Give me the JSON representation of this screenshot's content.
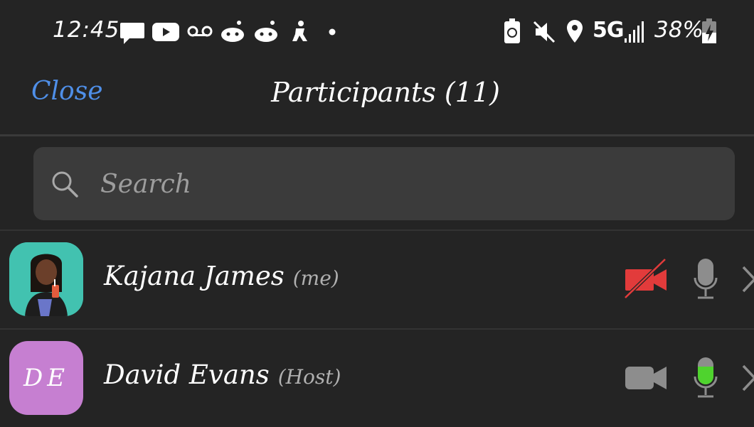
{
  "status_bar": {
    "time": "12:45",
    "network": "5G",
    "battery": "38%",
    "icons": [
      "message-icon",
      "youtube-icon",
      "voicemail-icon",
      "reddit-icon",
      "reddit-icon",
      "gym-icon",
      "dot-icon",
      "battery-saver-icon",
      "mute-icon",
      "location-icon",
      "signal-icon",
      "battery-charging-icon"
    ]
  },
  "header": {
    "close_label": "Close",
    "title": "Participants (11)"
  },
  "search": {
    "placeholder": "Search"
  },
  "participants": [
    {
      "name": "Kajana James",
      "tag": "(me)",
      "avatar_type": "photo",
      "video": "off",
      "mic": "muted"
    },
    {
      "name": "David Evans",
      "tag": "(Host)",
      "avatar_initials": "DE",
      "avatar_color": "#c67fd1",
      "video": "on",
      "mic": "active"
    }
  ],
  "colors": {
    "accent": "#4f8fe8",
    "video_off": "#e23b3b",
    "mic_active": "#4fd32e",
    "icon_grey": "#8d8d8d"
  }
}
